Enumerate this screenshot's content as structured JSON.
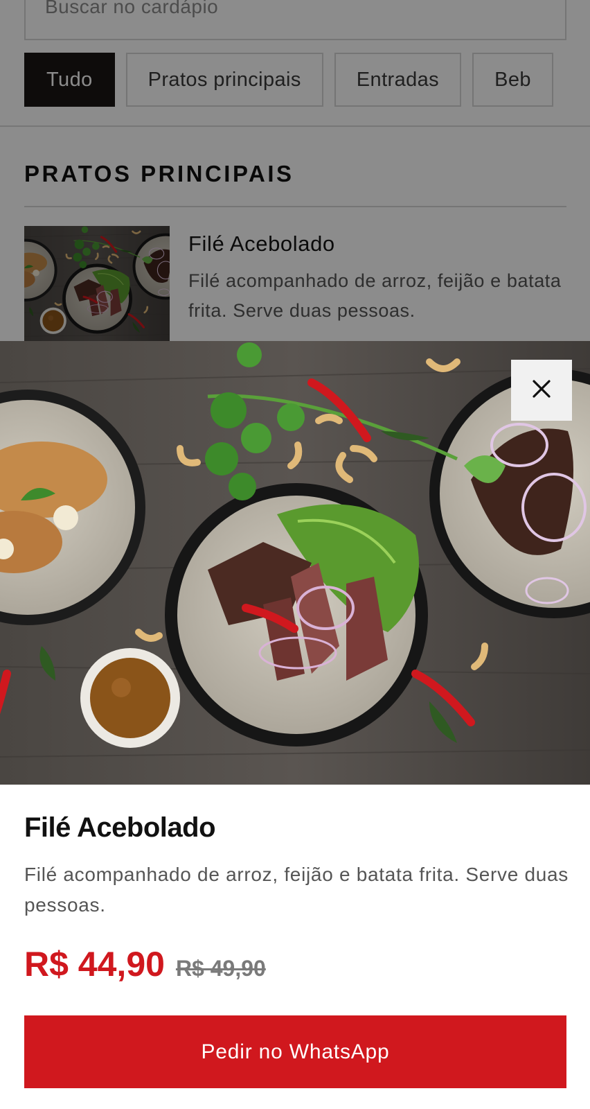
{
  "search": {
    "placeholder": "Buscar no cardápio"
  },
  "categories": [
    {
      "label": "Tudo",
      "active": true
    },
    {
      "label": "Pratos principais",
      "active": false
    },
    {
      "label": "Entradas",
      "active": false
    },
    {
      "label": "Beb",
      "active": false
    }
  ],
  "section": {
    "title": "PRATOS PRINCIPAIS"
  },
  "menu_item": {
    "name": "Filé Acebolado",
    "description": "Filé acompanhado de arroz, feijão e batata frita. Serve duas pessoas.",
    "image": "grilled-steak-bowls-photo"
  },
  "modal": {
    "image": "grilled-steak-bowls-photo",
    "close_icon": "close-icon",
    "title": "Filé Acebolado",
    "description": "Filé acompanhado de arroz, feijão e batata frita. Serve duas pessoas.",
    "price": "R$ 44,90",
    "old_price": "R$ 49,90",
    "order_button": "Pedir no WhatsApp"
  },
  "colors": {
    "accent": "#d0181e",
    "chip_active": "#1b1714",
    "overlay": "rgba(0,0,0,0.45)"
  }
}
